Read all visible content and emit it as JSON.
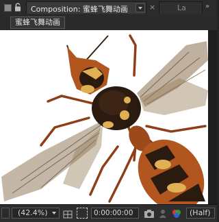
{
  "tabs": {
    "active_label": "Composition: 蜜蜂飞舞动画",
    "close_symbol": "×",
    "second_label": "La",
    "overflow_symbol": "»"
  },
  "breadcrumb": {
    "label": "蜜蜂飞舞动画"
  },
  "viewer": {
    "background": "#ffffff",
    "subject": "wasp-image"
  },
  "bottom_bar": {
    "zoom": "(42.4%)",
    "timecode": "0:00:00:00",
    "resolution": "(Half)"
  },
  "colors": {
    "panel_bg": "#232323",
    "tab_active": "#3a3a3a",
    "wasp_orange": "#b2561f",
    "wasp_yellow": "#e0b052",
    "wasp_dark": "#2a1a10"
  }
}
